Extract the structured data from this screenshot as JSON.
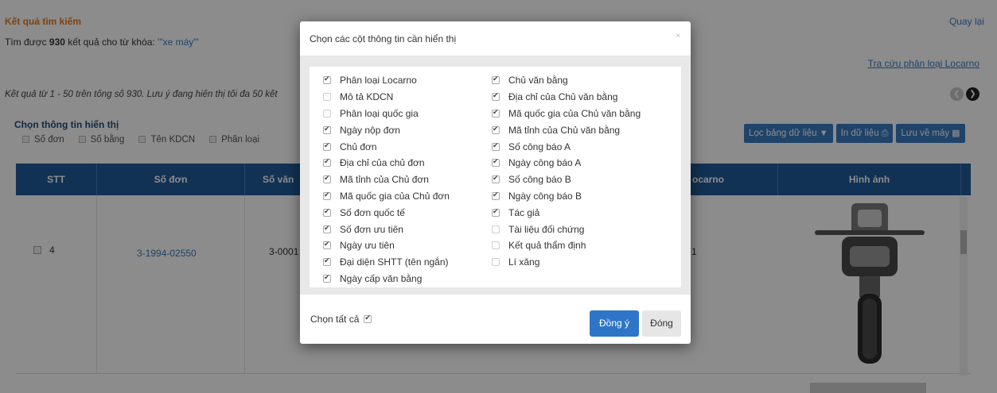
{
  "page": {
    "results_title": "Kết quả tìm kiếm",
    "back_link": "Quay lại",
    "found_prefix": "Tìm được ",
    "found_count": "930",
    "found_middle": " kết quả cho từ khóa: ",
    "found_keyword": "'\"xe máy\"'",
    "locarno_link": "Tra cứu phân loại Locarno",
    "range_text": "Kết quả từ 1 - 50 trên tổng số 930. Lưu ý đang hiển thị tối đa 50 kết",
    "display_title": "Chọn thông tin hiển thị",
    "display_options": [
      "Số đơn",
      "Số bằng",
      "Tên KDCN",
      "Phân loại"
    ],
    "buttons": {
      "filter": "Lọc bảng dữ liệu",
      "print": "In dữ liệu",
      "save": "Lưu về máy"
    },
    "columns": {
      "stt": "STT",
      "so_don": "Số đơn",
      "so_van": "Số văn",
      "locarno": "ocarno",
      "hinh_anh": "Hình ảnh"
    },
    "row": {
      "stt": "4",
      "so_don": "3-1994-02550",
      "so_van": "3-0001",
      "locarno": "1"
    }
  },
  "modal": {
    "title": "Chọn các cột thông tin cần hiển thị",
    "close_symbol": "×",
    "left_options": [
      {
        "label": "Phân loại Locarno",
        "checked": true
      },
      {
        "label": "Mô tả KDCN",
        "checked": false
      },
      {
        "label": "Phân loại quốc gia",
        "checked": false
      },
      {
        "label": "Ngày nộp đơn",
        "checked": true
      },
      {
        "label": "Chủ đơn",
        "checked": true
      },
      {
        "label": "Địa chỉ của chủ đơn",
        "checked": true
      },
      {
        "label": "Mã tỉnh của Chủ đơn",
        "checked": true
      },
      {
        "label": "Mã quốc gia của Chủ đơn",
        "checked": true
      },
      {
        "label": "Số đơn quốc tế",
        "checked": true
      },
      {
        "label": "Số đơn ưu tiên",
        "checked": true
      },
      {
        "label": "Ngày ưu tiên",
        "checked": true
      },
      {
        "label": "Đại diện SHTT (tên ngắn)",
        "checked": true
      },
      {
        "label": "Ngày cấp văn bằng",
        "checked": true
      }
    ],
    "right_options": [
      {
        "label": "Chủ văn bằng",
        "checked": true
      },
      {
        "label": "Địa chỉ của Chủ văn bằng",
        "checked": true
      },
      {
        "label": "Mã quốc gia của Chủ văn bằng",
        "checked": true
      },
      {
        "label": "Mã tỉnh của Chủ văn bằng",
        "checked": true
      },
      {
        "label": "Số công báo A",
        "checked": true
      },
      {
        "label": "Ngày công báo A",
        "checked": true
      },
      {
        "label": "Số công báo B",
        "checked": true
      },
      {
        "label": "Ngày công báo B",
        "checked": true
      },
      {
        "label": "Tác giả",
        "checked": true
      },
      {
        "label": "Tài liệu đối chứng",
        "checked": false
      },
      {
        "label": "Kết quả thẩm định",
        "checked": false
      },
      {
        "label": "Lí xăng",
        "checked": false
      }
    ],
    "select_all_label": "Chọn tất cả",
    "ok_label": "Đồng ý",
    "close_label": "Đóng"
  },
  "colors": {
    "accent": "#2e75c8",
    "table_header": "#1f5c99",
    "title_orange": "#e07b1e",
    "link_blue": "#3a7bbf"
  }
}
